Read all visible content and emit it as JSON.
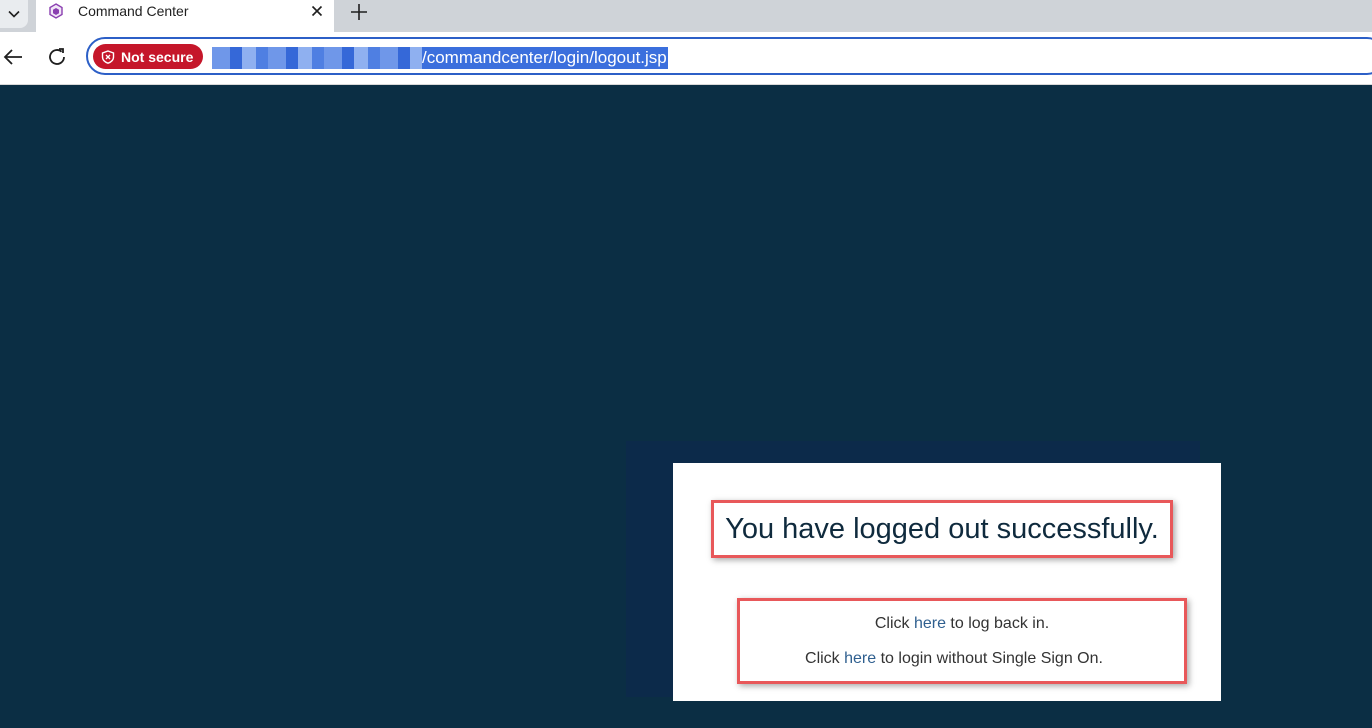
{
  "browser": {
    "tab": {
      "title": "Command Center"
    },
    "address_bar": {
      "security_label": "Not secure",
      "url_path": "/commandcenter/login/logout.jsp"
    }
  },
  "page": {
    "headline": "You have logged out successfully.",
    "login_back": {
      "prefix": "Click ",
      "link": "here",
      "suffix": " to log back in."
    },
    "login_no_sso": {
      "prefix": "Click ",
      "link": "here",
      "suffix": " to login without Single Sign On."
    }
  },
  "colors": {
    "page_background": "#0b2e44",
    "highlight_border": "#e8585a",
    "link": "#2f5f8f",
    "not_secure_chip": "#c5162a"
  }
}
